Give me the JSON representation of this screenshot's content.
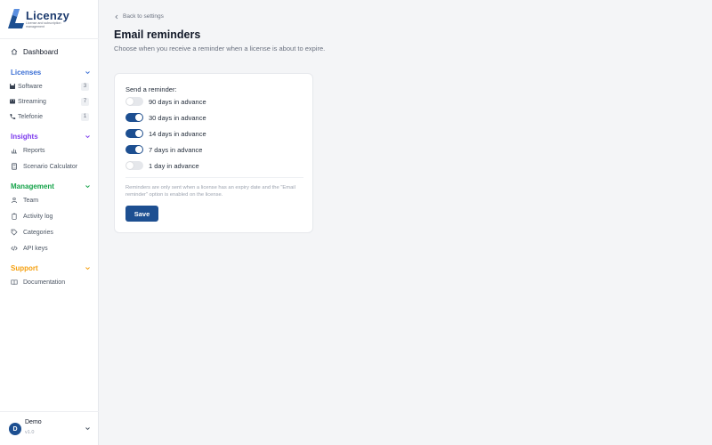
{
  "brand": {
    "name": "Licenzy",
    "tagline": "License and subscription management",
    "logo_color": "#1d4f91"
  },
  "sidebar": {
    "dashboard": {
      "label": "Dashboard",
      "icon": "home-icon"
    },
    "sections": [
      {
        "label": "Licenses",
        "color": "#3b6fd4",
        "items": [
          {
            "label": "Software",
            "icon": "floppy-icon",
            "count": "3"
          },
          {
            "label": "Streaming",
            "icon": "film-icon",
            "count": "7"
          },
          {
            "label": "Telefonie",
            "icon": "phone-icon",
            "count": "1"
          }
        ]
      },
      {
        "label": "Insights",
        "color": "#7c3aed",
        "items": [
          {
            "label": "Reports",
            "icon": "bar-chart-icon"
          },
          {
            "label": "Scenario Calculator",
            "icon": "calculator-icon"
          }
        ]
      },
      {
        "label": "Management",
        "color": "#16a34a",
        "items": [
          {
            "label": "Team",
            "icon": "team-icon"
          },
          {
            "label": "Activity log",
            "icon": "clipboard-icon"
          },
          {
            "label": "Categories",
            "icon": "tag-icon"
          },
          {
            "label": "API keys",
            "icon": "code-icon"
          }
        ]
      },
      {
        "label": "Support",
        "color": "#f59e0b",
        "items": [
          {
            "label": "Documentation",
            "icon": "book-icon"
          }
        ]
      }
    ]
  },
  "user": {
    "initial": "D",
    "name": "Demo",
    "version": "v1.0"
  },
  "page": {
    "back_label": "Back to settings",
    "title": "Email reminders",
    "subtitle": "Choose when you receive a reminder when a license is about to expire."
  },
  "reminders": {
    "label": "Send a reminder:",
    "options": [
      {
        "label": "90 days in advance",
        "enabled": false
      },
      {
        "label": "30 days in advance",
        "enabled": true
      },
      {
        "label": "14 days in advance",
        "enabled": true
      },
      {
        "label": "7 days in advance",
        "enabled": true
      },
      {
        "label": "1 day in advance",
        "enabled": false
      }
    ],
    "note": "Reminders are only sent when a license has an expiry date and the \"Email reminder\" option is enabled on the license.",
    "save_label": "Save"
  },
  "colors": {
    "accent": "#1d4f91",
    "toggle_off": "#e5e7eb"
  }
}
